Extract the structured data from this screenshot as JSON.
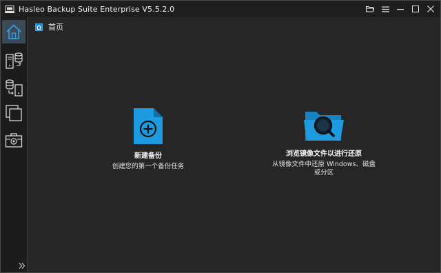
{
  "window": {
    "title": "Hasleo Backup Suite Enterprise V5.5.2.0"
  },
  "titlebar_controls": [
    {
      "name": "open-folder-icon"
    },
    {
      "name": "menu-icon"
    },
    {
      "name": "minimize-icon"
    },
    {
      "name": "maximize-icon"
    },
    {
      "name": "close-icon"
    }
  ],
  "sidebar": {
    "items": [
      {
        "name": "home",
        "icon": "home-icon",
        "active": true
      },
      {
        "name": "backup",
        "icon": "backup-icon",
        "active": false
      },
      {
        "name": "restore",
        "icon": "restore-icon",
        "active": false
      },
      {
        "name": "clone",
        "icon": "clone-icon",
        "active": false
      },
      {
        "name": "tools",
        "icon": "toolbox-icon",
        "active": false
      }
    ],
    "expand_icon": "double-chevron-right-icon"
  },
  "breadcrumb": {
    "label": "首页"
  },
  "actions": {
    "new_backup": {
      "title": "新建备份",
      "description": "创建您的第一个备份任务",
      "icon": "new-file-plus-icon"
    },
    "browse_image": {
      "title": "浏览镜像文件以进行还原",
      "description_line1": "从镜像文件中还原 Windows、磁盘",
      "description_line2": "或分区",
      "icon": "folder-search-icon"
    }
  },
  "colors": {
    "accent": "#1e9be0",
    "background": "#262626",
    "sidebar_bg": "#1c1c1c",
    "titlebar_bg": "#1e1e1e",
    "active_item_bg": "#3c4a57"
  }
}
